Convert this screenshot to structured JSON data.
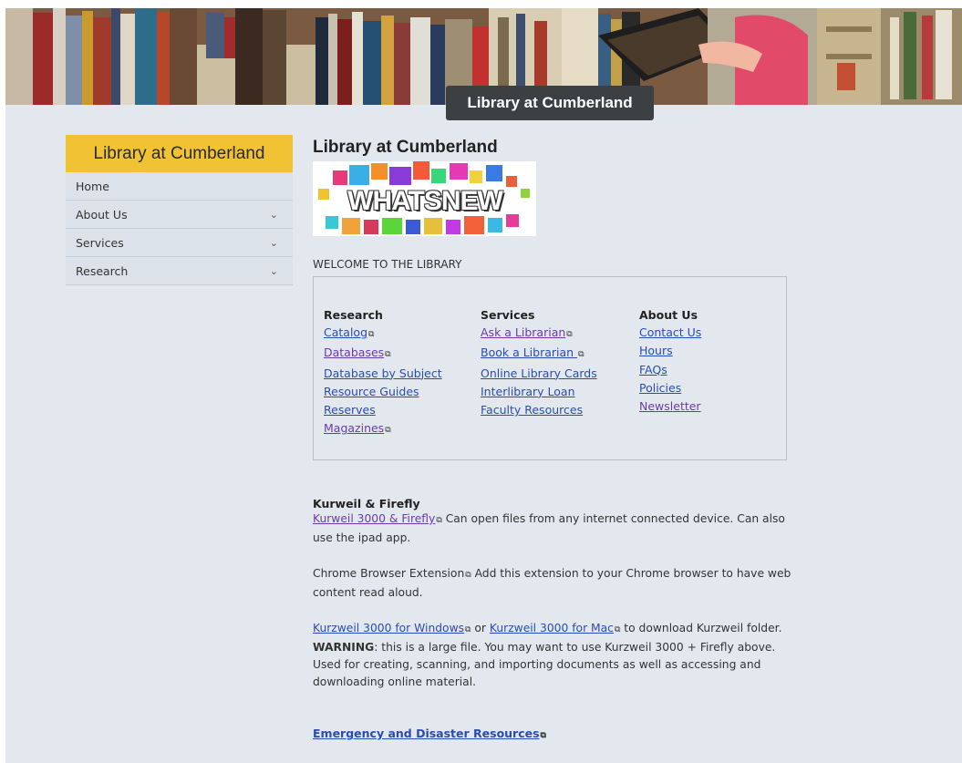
{
  "banner": {
    "title": "Library at Cumberland"
  },
  "sidebar": {
    "header": "Library at Cumberland",
    "items": [
      {
        "label": "Home",
        "expandable": false
      },
      {
        "label": "About Us",
        "expandable": true
      },
      {
        "label": "Services",
        "expandable": true
      },
      {
        "label": "Research",
        "expandable": true
      }
    ]
  },
  "main": {
    "title": "Library at Cumberland",
    "whatsnew_text": "WHATSNEW",
    "welcome": "WELCOME TO THE LIBRARY",
    "columns": [
      {
        "heading": "Research",
        "links": [
          {
            "label": "Catalog",
            "external": true
          },
          {
            "label": "Databases",
            "external": true
          },
          {
            "label": "Database by Subject",
            "external": false
          },
          {
            "label": "Resource Guides",
            "external": false
          },
          {
            "label": "Reserves",
            "external": false
          },
          {
            "label": "Magazines",
            "external": true
          }
        ]
      },
      {
        "heading": "Services",
        "links": [
          {
            "label": "Ask a Librarian",
            "external": true
          },
          {
            "label": "Book a Librarian ",
            "external": true
          },
          {
            "label": "Online Library Cards",
            "external": false
          },
          {
            "label": "Interlibrary Loan ",
            "external": false
          },
          {
            "label": "Faculty Resources",
            "external": false
          }
        ]
      },
      {
        "heading": "About Us",
        "links": [
          {
            "label": "Contact Us",
            "external": false
          },
          {
            "label": "Hours",
            "external": false
          },
          {
            "label": "FAQs",
            "external": false
          },
          {
            "label": "Policies",
            "external": false
          },
          {
            "label": "Newsletter",
            "external": false
          }
        ]
      }
    ],
    "kurzweil": {
      "heading": "Kurweil & Firefly",
      "p1_link": "Kurweil 3000 & Firefly",
      "p1_text": "  Can open files from any internet connected device.  Can also use the ipad app.",
      "p2_label": "Chrome Browser Extension",
      "p2_text": "  Add  this extension to your Chrome browser to have web content read aloud.",
      "p3_link1": "Kurzweil 3000 for Windows",
      "p3_or": " or ",
      "p3_link2": "Kurzweil 3000 for Mac",
      "p3_text1": " to download Kurzweil folder.  ",
      "p3_warning": "WARNING",
      "p3_text2": ":  this is a large file.  You may want to use Kurzweil 3000 + Firefly above.  Used for creating, scanning, and importing documents as well as accessing and downloading online material."
    },
    "emergency_link": "Emergency and Disaster Resources"
  },
  "icons": {
    "external": "external-link-icon",
    "chevron": "chevron-down-icon"
  },
  "colors": {
    "accent": "#f1c334",
    "link": "#2a4bb5",
    "visited": "#6b3aa8",
    "panel": "#e3e8ef"
  }
}
